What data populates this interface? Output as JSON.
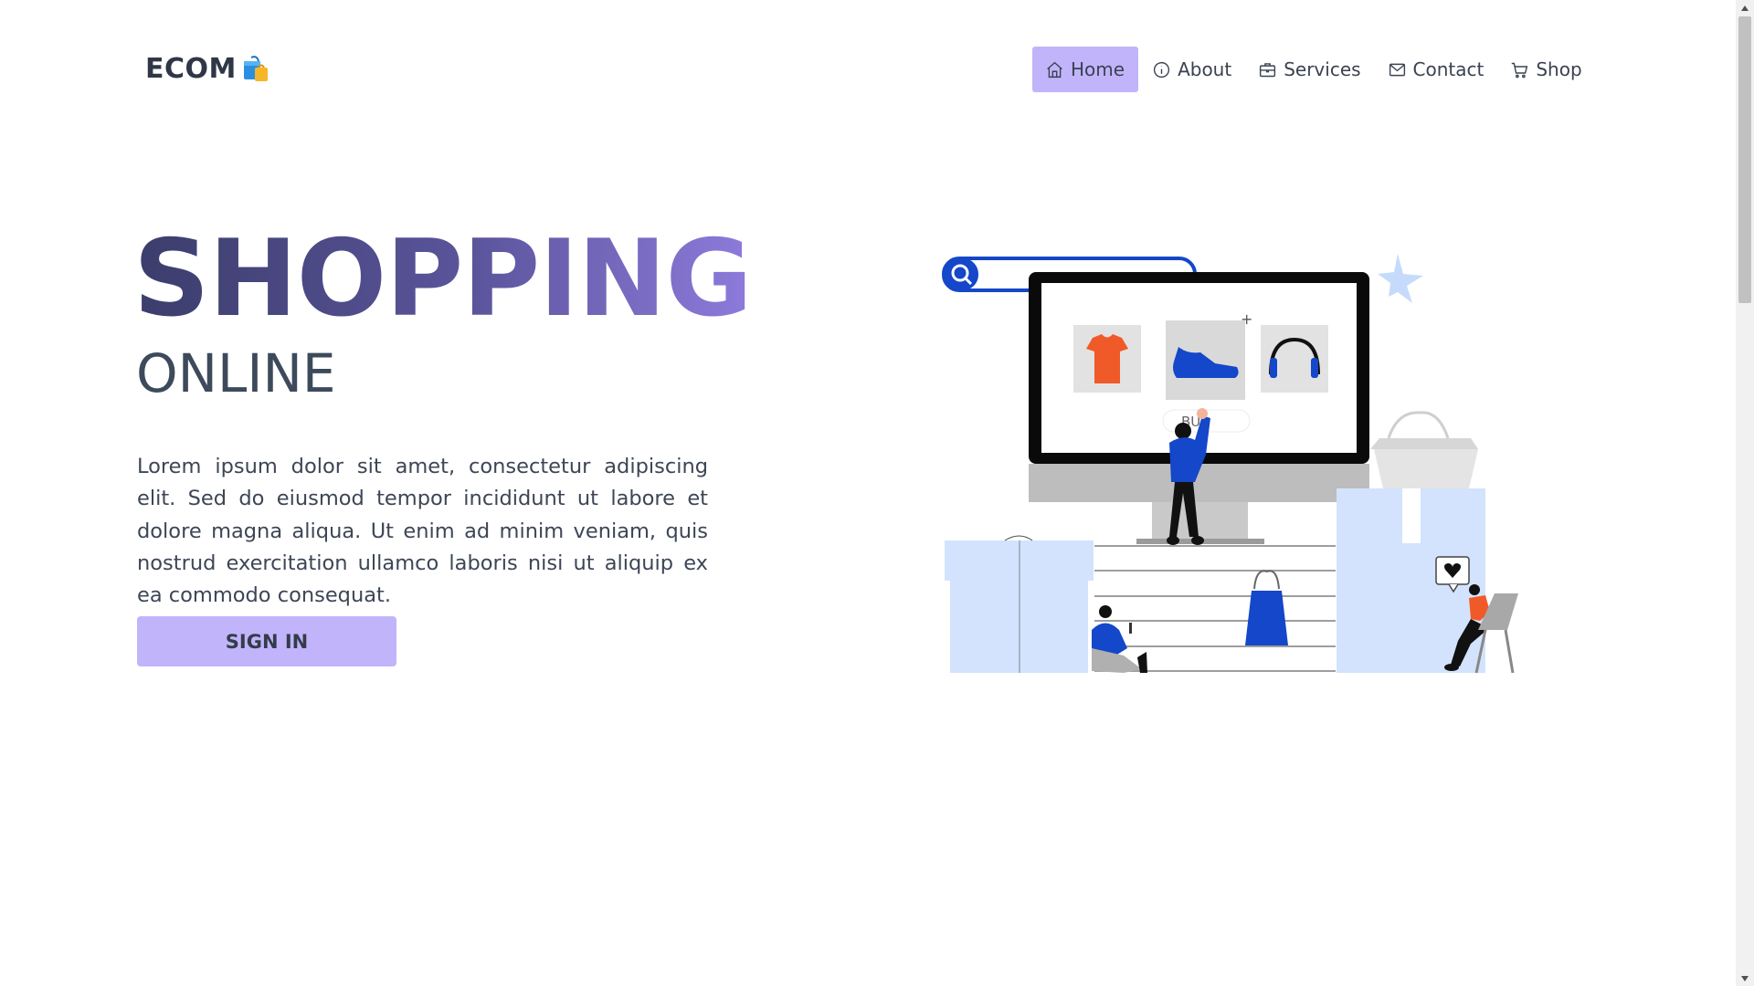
{
  "brand": {
    "name": "ECOM"
  },
  "nav": {
    "items": [
      {
        "label": "Home",
        "icon": "home-icon",
        "active": true
      },
      {
        "label": "About",
        "icon": "info-icon",
        "active": false
      },
      {
        "label": "Services",
        "icon": "briefcase-icon",
        "active": false
      },
      {
        "label": "Contact",
        "icon": "mail-icon",
        "active": false
      },
      {
        "label": "Shop",
        "icon": "cart-icon",
        "active": false
      }
    ]
  },
  "hero": {
    "title": "SHOPPING",
    "subtitle": "ONLINE",
    "text": "Lorem ipsum dolor sit amet, consectetur adipiscing elit. Sed do eiusmod tempor incididunt ut labore et dolore magna aliqua. Ut enim ad minim veniam, quis nostrud exercitation ullamco laboris nisi ut aliquip ex ea commodo consequat.",
    "button_label": "SIGN IN"
  },
  "illustration": {
    "screen_button_label": "BU"
  },
  "colors": {
    "accent": "#c2b4fb",
    "title_gradient_start": "#3b3d6b",
    "title_gradient_end": "#8e7bdc",
    "illustration_blue": "#1447c9",
    "illustration_orange": "#f05a28",
    "illustration_light_blue": "#d3e3fd"
  }
}
